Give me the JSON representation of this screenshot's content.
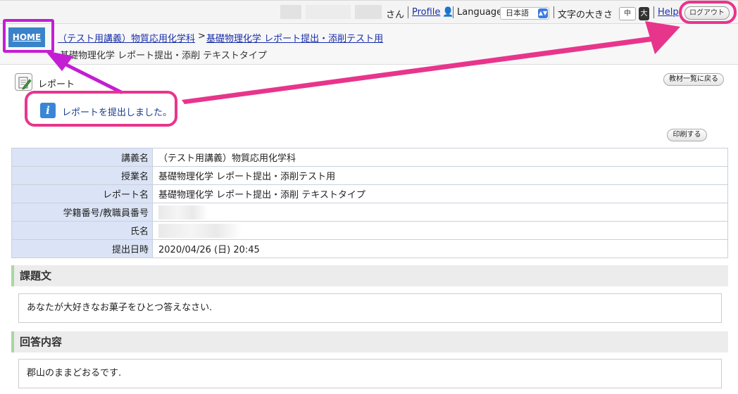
{
  "topbar": {
    "san": "さん",
    "profile": "Profile",
    "language_label": "Language",
    "language_value": "日本語",
    "font_size_label": "文字の大きさ",
    "size_medium": "中",
    "size_large": "大",
    "help": "Help",
    "logout": "ログアウト"
  },
  "header": {
    "home": "HOME",
    "breadcrumb": [
      "（テスト用講義）物質応用化学科",
      "基礎物理化学 レポート提出・添削テスト用"
    ],
    "breadcrumb_separator": ">",
    "subtitle": "基礎物理化学 レポート提出・添削 テキストタイプ"
  },
  "section": {
    "title": "レポート",
    "back_button": "教材一覧に戻る",
    "print_button": "印刷する"
  },
  "message": {
    "text": "レポートを提出しました。"
  },
  "details": [
    {
      "label": "講義名",
      "value": "（テスト用講義）物質応用化学科"
    },
    {
      "label": "授業名",
      "value": "基礎物理化学 レポート提出・添削テスト用"
    },
    {
      "label": "レポート名",
      "value": "基礎物理化学 レポート提出・添削 テキストタイプ"
    },
    {
      "label": "学籍番号/教職員番号",
      "value": ""
    },
    {
      "label": "氏名",
      "value": ""
    },
    {
      "label": "提出日時",
      "value": "2020/04/26 (日) 20:45"
    }
  ],
  "assignment": {
    "heading": "課題文",
    "text": "あなたが大好きなお菓子をひとつ答えなさい."
  },
  "answer": {
    "heading": "回答内容",
    "text": "郡山のままどおるです."
  },
  "colors": {
    "annotation_pink": "#e8358c",
    "annotation_purple": "#c31ed3",
    "home_blue": "#3a83c9",
    "label_bg": "#dbe4f6"
  }
}
